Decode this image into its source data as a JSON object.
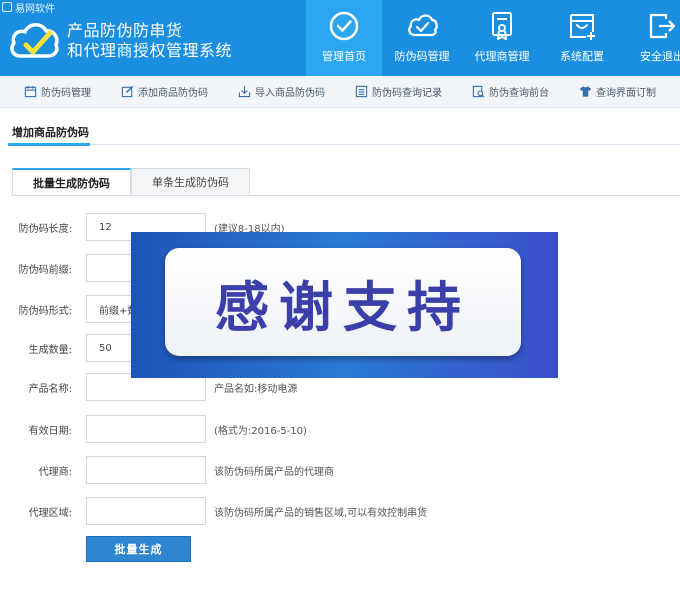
{
  "brand": {
    "tag": "易网软件"
  },
  "app": {
    "title_line1": "产品防伪防串货",
    "title_line2": "和代理商授权管理系统"
  },
  "nav": [
    {
      "label": "管理首页",
      "icon": "check-circle-icon",
      "active": true
    },
    {
      "label": "防伪码管理",
      "icon": "cloud-check-icon",
      "active": false
    },
    {
      "label": "代理商管理",
      "icon": "certificate-icon",
      "active": false
    },
    {
      "label": "系统配置",
      "icon": "settings-box-icon",
      "active": false
    },
    {
      "label": "安全退出",
      "icon": "logout-icon",
      "active": false
    }
  ],
  "subnav": [
    {
      "label": "防伪码管理",
      "icon": "calendar-icon"
    },
    {
      "label": "添加商品防伪码",
      "icon": "edit-icon"
    },
    {
      "label": "导入商品防伪码",
      "icon": "import-icon"
    },
    {
      "label": "防伪码查询记录",
      "icon": "list-icon"
    },
    {
      "label": "防伪查询前台",
      "icon": "search-doc-icon"
    },
    {
      "label": "查询界面订制",
      "icon": "shirt-icon"
    }
  ],
  "section": {
    "title": "增加商品防伪码"
  },
  "tabs": [
    {
      "label": "批量生成防伪码",
      "active": true
    },
    {
      "label": "单条生成防伪码",
      "active": false
    }
  ],
  "form": {
    "length": {
      "label": "防伪码长度:",
      "value": "12",
      "hint": "(建议8-18以内)"
    },
    "prefix": {
      "label": "防伪码前缀:",
      "value": ""
    },
    "format": {
      "label": "防伪码形式:",
      "value": "前缀+数"
    },
    "quantity": {
      "label": "生成数量:",
      "value": "50"
    },
    "product": {
      "label": "产品名称:",
      "value": "",
      "hint": "产品名如:移动电源"
    },
    "expiry": {
      "label": "有效日期:",
      "value": "",
      "hint": "(格式为:2016-5-10)"
    },
    "agent": {
      "label": "代理商:",
      "value": "",
      "hint": "该防伪码所属产品的代理商"
    },
    "region": {
      "label": "代理区域:",
      "value": "",
      "hint": "该防伪码所属产品的销售区域,可以有效控制串货"
    }
  },
  "submit": {
    "label": "批量生成"
  },
  "overlay": {
    "text": "感谢支持"
  },
  "colors": {
    "header": "#1a8fe0",
    "active_nav": "#2da6f2",
    "button": "#2d86cf",
    "overlay": "#2a7ad6"
  }
}
